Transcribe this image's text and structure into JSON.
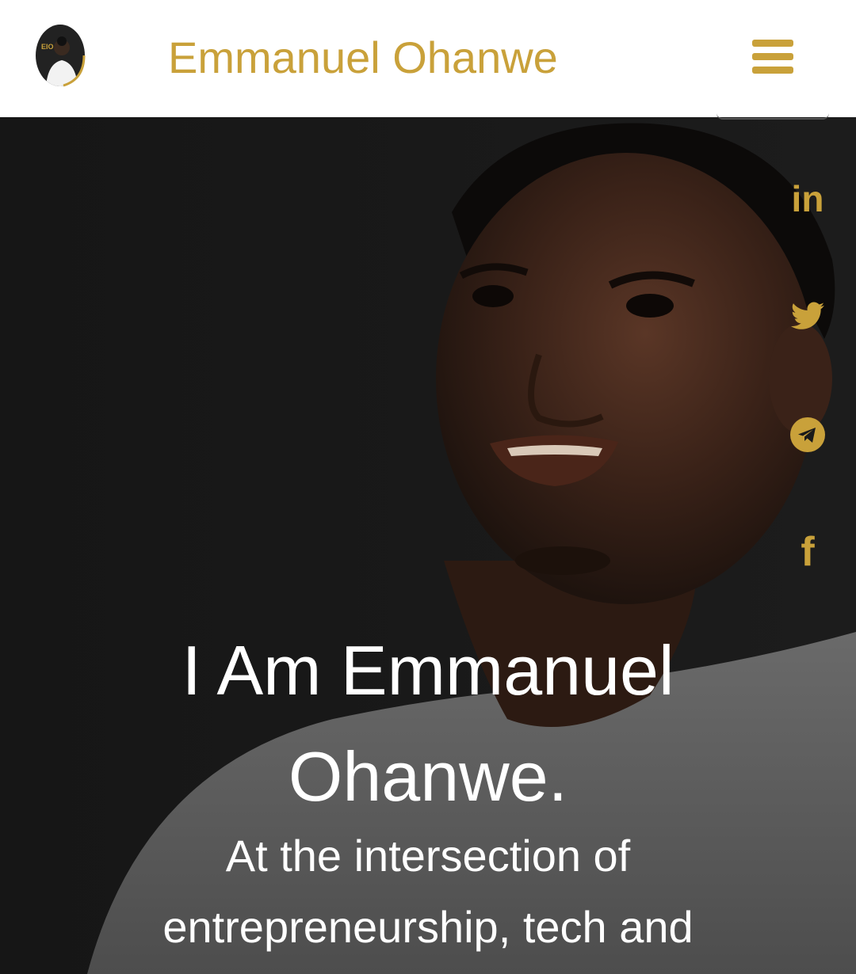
{
  "header": {
    "site_title": "Emmanuel Ohanwe",
    "logo_icon": "profile-avatar-logo",
    "logo_initials": "EIO",
    "menu_icon": "hamburger-menu-icon"
  },
  "social_links": [
    {
      "name": "linkedin",
      "icon": "linkedin-icon",
      "glyph": "in"
    },
    {
      "name": "twitter",
      "icon": "twitter-icon"
    },
    {
      "name": "telegram",
      "icon": "telegram-icon"
    },
    {
      "name": "facebook",
      "icon": "facebook-icon",
      "glyph": "f"
    }
  ],
  "hero": {
    "heading_line1": "I Am Emmanuel",
    "heading_line2": "Ohanwe.",
    "sub_line1": "At the intersection of",
    "sub_line2": "entrepreneurship, tech and"
  },
  "colors": {
    "accent": "#c9a13a",
    "header_bg": "#ffffff",
    "hero_text": "#ffffff"
  }
}
